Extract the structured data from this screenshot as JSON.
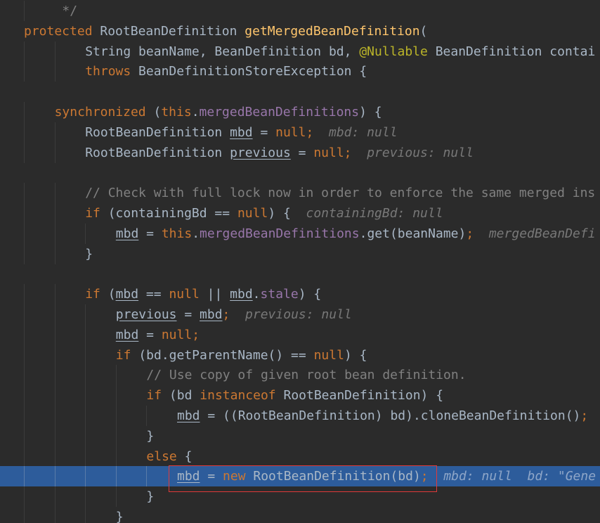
{
  "editor": {
    "lines": [
      {
        "indent": 1,
        "tokens": [
          {
            "t": " */",
            "c": "cmt"
          }
        ]
      },
      {
        "indent": 0,
        "tokens": [
          {
            "t": "protected",
            "c": "kw"
          },
          {
            "t": " RootBeanDefinition ",
            "c": ""
          },
          {
            "t": "getMergedBeanDefinition",
            "c": "fn"
          },
          {
            "t": "(",
            "c": ""
          }
        ]
      },
      {
        "indent": 2,
        "tokens": [
          {
            "t": "String beanName, BeanDefinition bd, ",
            "c": ""
          },
          {
            "t": "@Nullable",
            "c": "ann"
          },
          {
            "t": " BeanDefinition contai",
            "c": ""
          }
        ]
      },
      {
        "indent": 2,
        "tokens": [
          {
            "t": "throws",
            "c": "kw"
          },
          {
            "t": " BeanDefinitionStoreException {",
            "c": ""
          }
        ]
      },
      {
        "indent": 0,
        "tokens": []
      },
      {
        "indent": 1,
        "tokens": [
          {
            "t": "synchronized",
            "c": "kw"
          },
          {
            "t": " (",
            "c": ""
          },
          {
            "t": "this",
            "c": "kw"
          },
          {
            "t": ".",
            "c": ""
          },
          {
            "t": "mergedBeanDefinitions",
            "c": "field"
          },
          {
            "t": ") {",
            "c": ""
          }
        ]
      },
      {
        "indent": 2,
        "tokens": [
          {
            "t": "RootBeanDefinition ",
            "c": ""
          },
          {
            "t": "mbd",
            "c": "var"
          },
          {
            "t": " = ",
            "c": ""
          },
          {
            "t": "null",
            "c": "kw"
          },
          {
            "t": ";",
            "c": "kw"
          }
        ],
        "hint": "mbd: null"
      },
      {
        "indent": 2,
        "tokens": [
          {
            "t": "RootBeanDefinition ",
            "c": ""
          },
          {
            "t": "previous",
            "c": "var"
          },
          {
            "t": " = ",
            "c": ""
          },
          {
            "t": "null",
            "c": "kw"
          },
          {
            "t": ";",
            "c": "kw"
          }
        ],
        "hint": "previous: null"
      },
      {
        "indent": 0,
        "tokens": []
      },
      {
        "indent": 2,
        "tokens": [
          {
            "t": "// Check with full lock now in order to enforce the same merged ins",
            "c": "cmt"
          }
        ]
      },
      {
        "indent": 2,
        "tokens": [
          {
            "t": "if",
            "c": "kw"
          },
          {
            "t": " (containingBd == ",
            "c": ""
          },
          {
            "t": "null",
            "c": "kw"
          },
          {
            "t": ") {",
            "c": ""
          }
        ],
        "hint": "containingBd: null"
      },
      {
        "indent": 3,
        "tokens": [
          {
            "t": "mbd",
            "c": "var"
          },
          {
            "t": " = ",
            "c": ""
          },
          {
            "t": "this",
            "c": "kw"
          },
          {
            "t": ".",
            "c": ""
          },
          {
            "t": "mergedBeanDefinitions",
            "c": "field"
          },
          {
            "t": ".get(beanName)",
            "c": ""
          },
          {
            "t": ";",
            "c": "kw"
          }
        ],
        "hint": "mergedBeanDefi"
      },
      {
        "indent": 2,
        "tokens": [
          {
            "t": "}",
            "c": ""
          }
        ]
      },
      {
        "indent": 0,
        "tokens": []
      },
      {
        "indent": 2,
        "tokens": [
          {
            "t": "if",
            "c": "kw"
          },
          {
            "t": " (",
            "c": ""
          },
          {
            "t": "mbd",
            "c": "var"
          },
          {
            "t": " == ",
            "c": ""
          },
          {
            "t": "null",
            "c": "kw"
          },
          {
            "t": " || ",
            "c": ""
          },
          {
            "t": "mbd",
            "c": "var"
          },
          {
            "t": ".",
            "c": ""
          },
          {
            "t": "stale",
            "c": "field"
          },
          {
            "t": ") {",
            "c": ""
          }
        ]
      },
      {
        "indent": 3,
        "tokens": [
          {
            "t": "previous",
            "c": "var"
          },
          {
            "t": " = ",
            "c": ""
          },
          {
            "t": "mbd",
            "c": "var"
          },
          {
            "t": ";",
            "c": "kw"
          }
        ],
        "hint": "previous: null"
      },
      {
        "indent": 3,
        "tokens": [
          {
            "t": "mbd",
            "c": "var"
          },
          {
            "t": " = ",
            "c": ""
          },
          {
            "t": "null",
            "c": "kw"
          },
          {
            "t": ";",
            "c": "kw"
          }
        ]
      },
      {
        "indent": 3,
        "tokens": [
          {
            "t": "if",
            "c": "kw"
          },
          {
            "t": " (bd.getParentName() == ",
            "c": ""
          },
          {
            "t": "null",
            "c": "kw"
          },
          {
            "t": ") {",
            "c": ""
          }
        ]
      },
      {
        "indent": 4,
        "tokens": [
          {
            "t": "// Use copy of given root bean definition.",
            "c": "cmt"
          }
        ]
      },
      {
        "indent": 4,
        "tokens": [
          {
            "t": "if",
            "c": "kw"
          },
          {
            "t": " (bd ",
            "c": ""
          },
          {
            "t": "instanceof",
            "c": "kw"
          },
          {
            "t": " RootBeanDefinition) {",
            "c": ""
          }
        ]
      },
      {
        "indent": 5,
        "tokens": [
          {
            "t": "mbd",
            "c": "var"
          },
          {
            "t": " = ((RootBeanDefinition) bd).cloneBeanDefinition()",
            "c": ""
          },
          {
            "t": ";",
            "c": "kw"
          }
        ]
      },
      {
        "indent": 4,
        "tokens": [
          {
            "t": "}",
            "c": ""
          }
        ]
      },
      {
        "indent": 4,
        "tokens": [
          {
            "t": "else",
            "c": "kw"
          },
          {
            "t": " {",
            "c": ""
          }
        ]
      },
      {
        "indent": 5,
        "current": true,
        "tokens": [
          {
            "t": "mbd",
            "c": "var"
          },
          {
            "t": " = ",
            "c": ""
          },
          {
            "t": "new",
            "c": "kw"
          },
          {
            "t": " RootBeanDefinition(bd)",
            "c": ""
          },
          {
            "t": ";",
            "c": "kw"
          }
        ],
        "hint": "mbd: null  bd: \"Gene"
      },
      {
        "indent": 4,
        "tokens": [
          {
            "t": "}",
            "c": ""
          }
        ]
      },
      {
        "indent": 3,
        "tokens": [
          {
            "t": "}",
            "c": ""
          }
        ]
      }
    ]
  },
  "colors": {
    "background": "#2b2b2b",
    "current_line": "#2d5c9b",
    "keyword": "#cc7832",
    "method": "#ffc66d",
    "field": "#9876aa",
    "comment": "#808080",
    "annotation": "#bbb529",
    "highlight_border": "#e03a3a"
  }
}
